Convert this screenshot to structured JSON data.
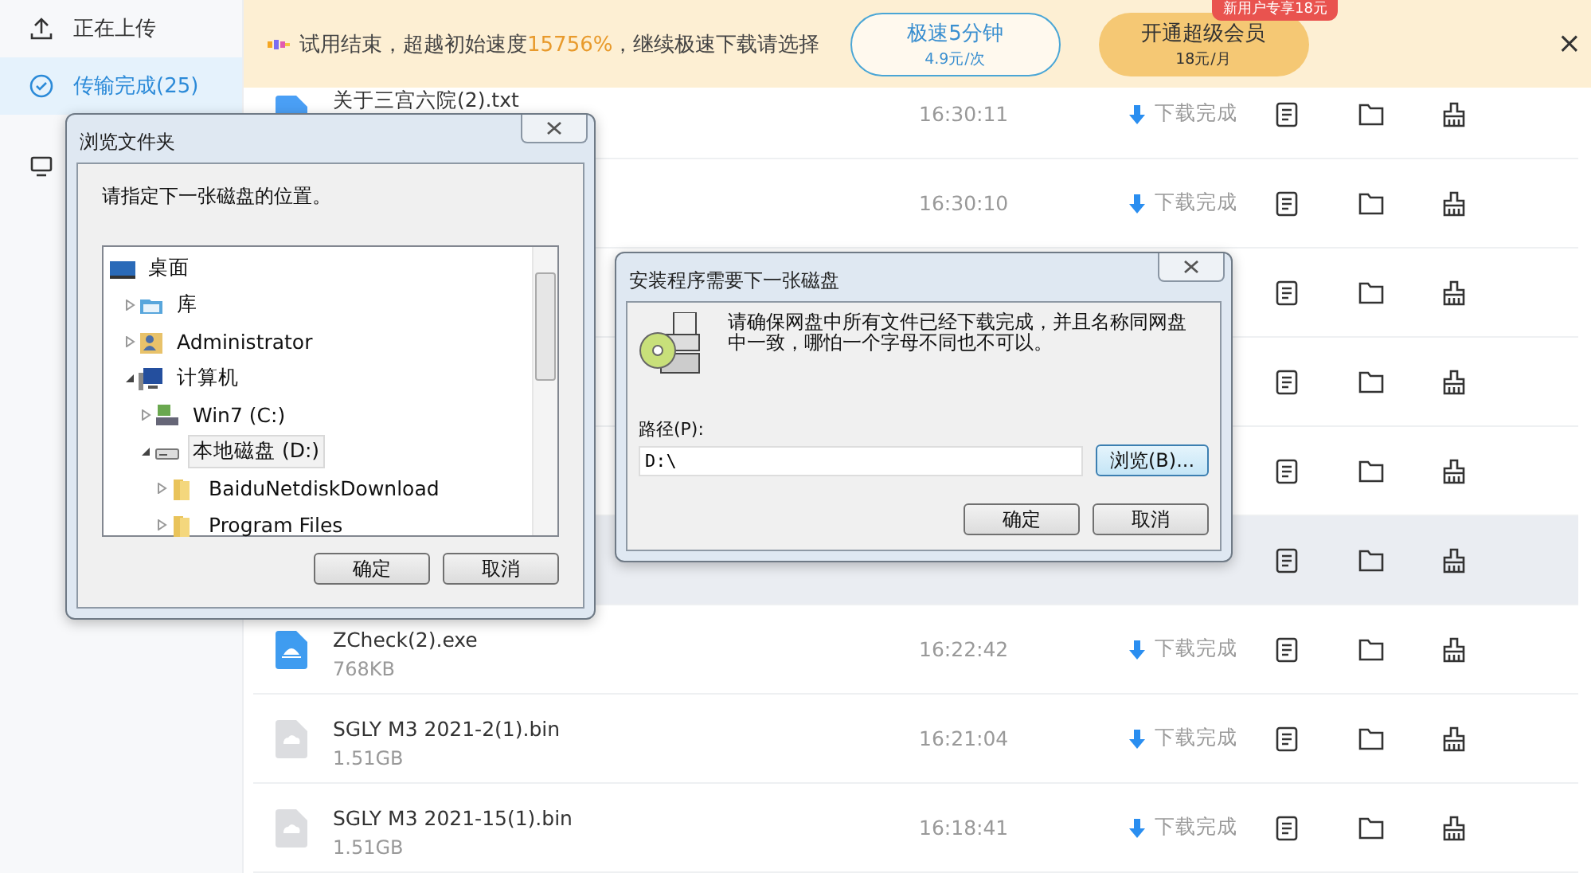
{
  "sidebar": {
    "items": [
      {
        "label": "正在上传",
        "selected": false
      },
      {
        "label": "传输完成(25)",
        "selected": true
      },
      {
        "selected": false
      }
    ]
  },
  "banner": {
    "text_before": "试用结束，超越初始速度",
    "highlight": "15756%",
    "text_after": "，继续极速下载请选择",
    "offers": [
      {
        "kind": "outline",
        "title": "极速5分钟",
        "price": "4.9元/次"
      },
      {
        "kind": "filled",
        "title": "开通超级会员",
        "price": "18元/月",
        "badge": "新用户专享18元"
      }
    ],
    "close": "×"
  },
  "rows": [
    {
      "kind": "document",
      "name": "关于三宫六院(2).txt",
      "time": "16:30:11",
      "status": "下载完成",
      "highlighted": false
    },
    {
      "kind": "hidden",
      "time": "16:30:10",
      "status": "下载完成",
      "highlighted": false
    },
    {
      "kind": "hidden",
      "highlighted": false
    },
    {
      "kind": "hidden",
      "highlighted": false
    },
    {
      "kind": "hidden",
      "highlighted": false
    },
    {
      "kind": "hidden",
      "highlighted": true
    },
    {
      "kind": "installer",
      "name": "ZCheck(2).exe",
      "size": "768KB",
      "time": "16:22:42",
      "status": "下载完成",
      "highlighted": false
    },
    {
      "kind": "cloud",
      "name": "SGLY M3 2021-2(1).bin",
      "size": "1.51GB",
      "time": "16:21:04",
      "status": "下载完成",
      "highlighted": false
    },
    {
      "kind": "cloud",
      "name": "SGLY M3 2021-15(1).bin",
      "size": "1.51GB",
      "time": "16:18:41",
      "status": "下载完成",
      "highlighted": false
    }
  ],
  "browse_dialog": {
    "title": "浏览文件夹",
    "prompt": "请指定下一张磁盘的位置。",
    "tree": [
      {
        "label": "桌面",
        "selected": false,
        "children": [
          {
            "label": "库",
            "expanded": false,
            "selected": false
          },
          {
            "label": "Administrator",
            "expanded": false,
            "selected": false
          },
          {
            "label": "计算机",
            "expanded": true,
            "selected": false,
            "children": [
              {
                "label": "Win7 (C:)",
                "expanded": false,
                "selected": false
              },
              {
                "label": "本地磁盘 (D:)",
                "expanded": true,
                "selected": true,
                "children": [
                  {
                    "label": "BaiduNetdiskDownload",
                    "expanded": false,
                    "selected": false
                  },
                  {
                    "label": "Program Files",
                    "expanded": false,
                    "selected": false
                  }
                ]
              }
            ]
          }
        ]
      }
    ],
    "buttons": [
      "确定",
      "取消"
    ]
  },
  "install_dialog": {
    "title": "安装程序需要下一张磁盘",
    "message": "请确保网盘中所有文件已经下载完成，并且名称同网盘中一致，哪怕一个字母不同也不可以。",
    "path_label": "路径(P):",
    "path_value": "D:\\",
    "browse_button": "浏览(B)...",
    "buttons": [
      "确定",
      "取消"
    ]
  }
}
